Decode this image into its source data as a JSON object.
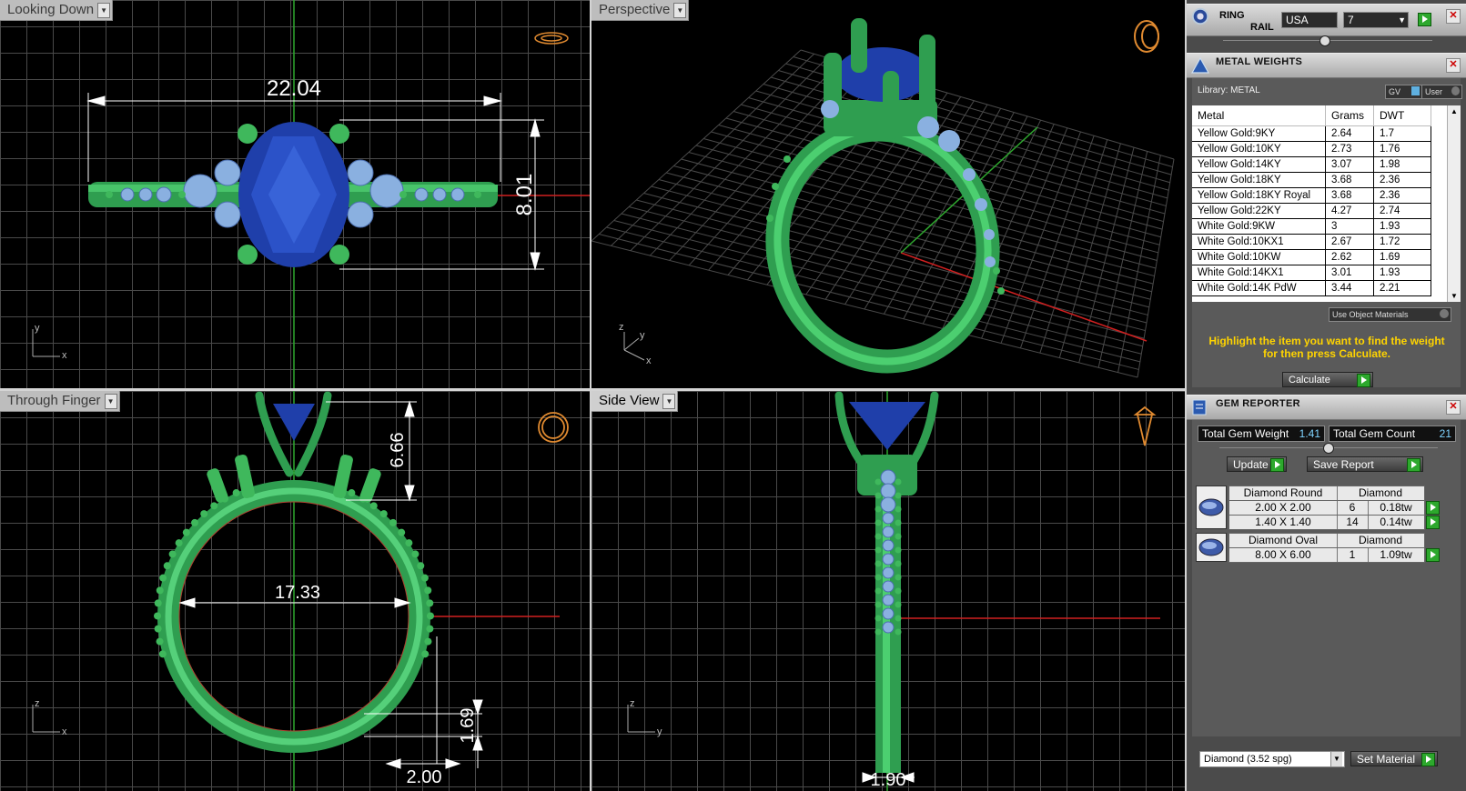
{
  "viewports": {
    "top_left": {
      "label": "Looking Down",
      "dim_width": "22.04",
      "dim_height": "8.01",
      "axes": [
        "y",
        "x"
      ]
    },
    "top_right": {
      "label": "Perspective",
      "axes": [
        "z",
        "y",
        "x"
      ]
    },
    "bottom_left": {
      "label": "Through Finger",
      "dim_top": "6.66",
      "dim_inner": "17.33",
      "dim_band_h": "1.69",
      "dim_band_w": "2.00",
      "axes": [
        "z",
        "x"
      ]
    },
    "bottom_right": {
      "label": "Side View",
      "dim_width": "1.90",
      "axes": [
        "z",
        "y"
      ]
    }
  },
  "ring_rail": {
    "title_1": "RING",
    "title_2": "RAIL",
    "standard": "USA",
    "size": "7"
  },
  "metal_weights": {
    "title": "METAL WEIGHTS",
    "library": "Library: METAL",
    "toggle_gv": "GV",
    "toggle_user": "User",
    "columns": [
      "Metal",
      "Grams",
      "DWT"
    ],
    "rows": [
      [
        "Yellow Gold:9KY",
        "2.64",
        "1.7"
      ],
      [
        "Yellow Gold:10KY",
        "2.73",
        "1.76"
      ],
      [
        "Yellow Gold:14KY",
        "3.07",
        "1.98"
      ],
      [
        "Yellow Gold:18KY",
        "3.68",
        "2.36"
      ],
      [
        "Yellow Gold:18KY Royal",
        "3.68",
        "2.36"
      ],
      [
        "Yellow Gold:22KY",
        "4.27",
        "2.74"
      ],
      [
        "White Gold:9KW",
        "3",
        "1.93"
      ],
      [
        "White Gold:10KX1",
        "2.67",
        "1.72"
      ],
      [
        "White Gold:10KW",
        "2.62",
        "1.69"
      ],
      [
        "White Gold:14KX1",
        "3.01",
        "1.93"
      ],
      [
        "White Gold:14K PdW",
        "3.44",
        "2.21"
      ]
    ],
    "use_object_materials": "Use Object Materials",
    "message": "Highlight the item you want to find the weight for then press Calculate.",
    "calculate": "Calculate"
  },
  "gem_reporter": {
    "title": "GEM REPORTER",
    "total_weight_label": "Total Gem Weight",
    "total_weight": "1.41",
    "total_count_label": "Total Gem Count",
    "total_count": "21",
    "update": "Update",
    "save_report": "Save Report",
    "groups": [
      {
        "name": "Diamond Round",
        "material": "Diamond",
        "rows": [
          [
            "2.00 X 2.00",
            "6",
            "0.18tw"
          ],
          [
            "1.40 X 1.40",
            "14",
            "0.14tw"
          ]
        ]
      },
      {
        "name": "Diamond Oval",
        "material": "Diamond",
        "rows": [
          [
            "8.00 X 6.00",
            "1",
            "1.09tw"
          ]
        ]
      }
    ],
    "material_select": "Diamond    (3.52 spg)",
    "set_material": "Set Material"
  }
}
